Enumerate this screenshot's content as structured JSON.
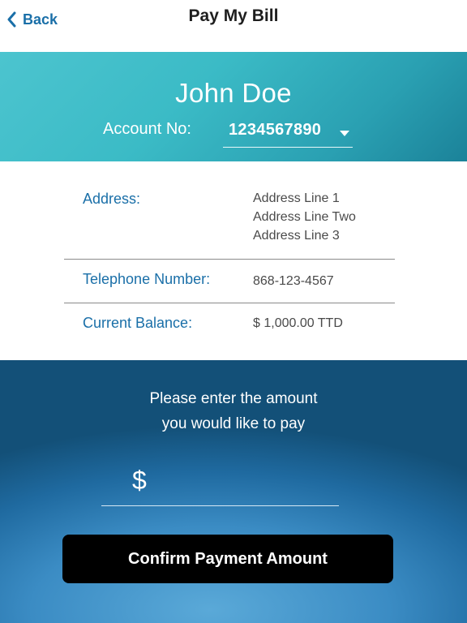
{
  "nav": {
    "back_label": "Back",
    "title": "Pay My Bill"
  },
  "account": {
    "customer_name": "John Doe",
    "number_label": "Account No:",
    "selected_number": "1234567890"
  },
  "details": {
    "address": {
      "label": "Address:",
      "lines": [
        "Address Line 1",
        "Address Line Two",
        "Address Line 3"
      ]
    },
    "telephone": {
      "label": "Telephone Number:",
      "value": "868-123-4567"
    },
    "balance": {
      "label": "Current Balance:",
      "value": "$ 1,000.00 TTD"
    }
  },
  "payment": {
    "prompt_line1": "Please enter the amount",
    "prompt_line2": "you would like to pay",
    "currency_symbol": "$",
    "amount_value": "",
    "confirm_label": "Confirm Payment Amount"
  },
  "colors": {
    "accent_blue": "#1a6fa8",
    "header_teal": "#3bbbc6",
    "button_black": "#000000"
  },
  "icons": {
    "back": "chevron-left-icon",
    "dropdown": "caret-down-icon"
  }
}
